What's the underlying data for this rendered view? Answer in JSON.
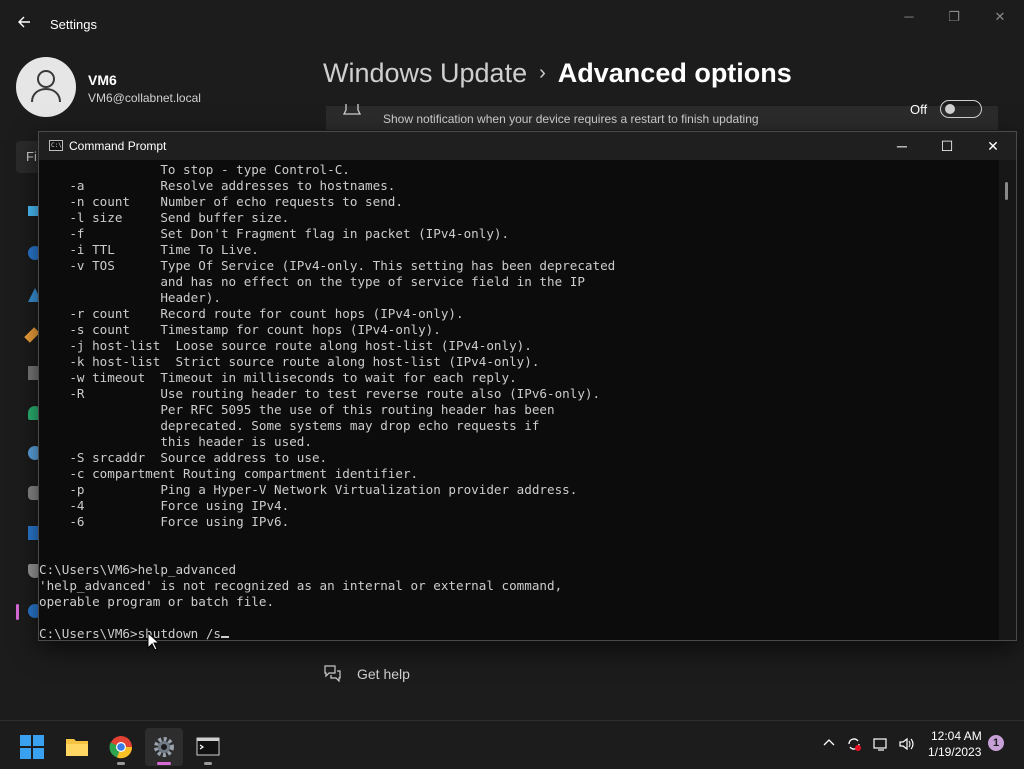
{
  "settings": {
    "app_title": "Settings",
    "user": {
      "name": "VM6",
      "email": "VM6@collabnet.local"
    },
    "search_placeholder": "Fi",
    "breadcrumb": {
      "parent": "Windows Update",
      "separator": "›",
      "current": "Advanced options"
    },
    "notify_setting": {
      "description": "Show notification when your device requires a restart to finish updating",
      "toggle_state": "Off"
    },
    "get_help": "Get help"
  },
  "cmd": {
    "title": "Command Prompt",
    "lines": [
      "                To stop - type Control-C.",
      "    -a          Resolve addresses to hostnames.",
      "    -n count    Number of echo requests to send.",
      "    -l size     Send buffer size.",
      "    -f          Set Don't Fragment flag in packet (IPv4-only).",
      "    -i TTL      Time To Live.",
      "    -v TOS      Type Of Service (IPv4-only. This setting has been deprecated",
      "                and has no effect on the type of service field in the IP",
      "                Header).",
      "    -r count    Record route for count hops (IPv4-only).",
      "    -s count    Timestamp for count hops (IPv4-only).",
      "    -j host-list  Loose source route along host-list (IPv4-only).",
      "    -k host-list  Strict source route along host-list (IPv4-only).",
      "    -w timeout  Timeout in milliseconds to wait for each reply.",
      "    -R          Use routing header to test reverse route also (IPv6-only).",
      "                Per RFC 5095 the use of this routing header has been",
      "                deprecated. Some systems may drop echo requests if",
      "                this header is used.",
      "    -S srcaddr  Source address to use.",
      "    -c compartment Routing compartment identifier.",
      "    -p          Ping a Hyper-V Network Virtualization provider address.",
      "    -4          Force using IPv4.",
      "    -6          Force using IPv6.",
      "",
      "",
      "C:\\Users\\VM6>help_advanced",
      "'help_advanced' is not recognized as an internal or external command,",
      "operable program or batch file.",
      ""
    ],
    "prompt": "C:\\Users\\VM6>",
    "current_input": "shutdown /s"
  },
  "taskbar": {
    "apps": [
      "start-icon",
      "file-explorer-icon",
      "chrome-icon",
      "settings-icon",
      "terminal-icon"
    ],
    "active_app": "settings-icon",
    "time": "12:04 AM",
    "date": "1/19/2023",
    "notification_count": "1"
  },
  "colors": {
    "accent": "#d86ad7",
    "windows_blue": "#0078d4",
    "console_text": "#cccccc",
    "console_bg": "#0c0c0c"
  }
}
